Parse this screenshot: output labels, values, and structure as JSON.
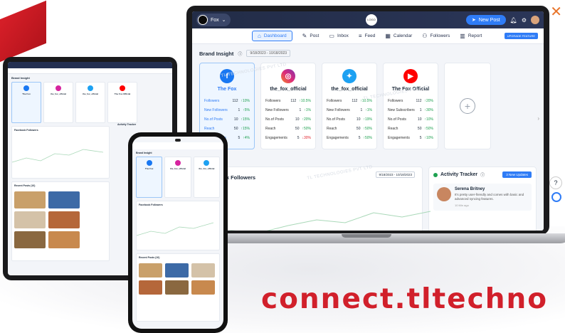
{
  "topbar": {
    "brand_name": "Fox",
    "center_logo_text": "LOGO",
    "new_post_label": "New Post"
  },
  "nav": {
    "items": [
      {
        "label": "Dashboard",
        "icon": "home-icon",
        "active": true
      },
      {
        "label": "Post",
        "icon": "edit-icon",
        "active": false
      },
      {
        "label": "Inbox",
        "icon": "inbox-icon",
        "active": false
      },
      {
        "label": "Feed",
        "icon": "feed-icon",
        "active": false
      },
      {
        "label": "Calendar",
        "icon": "calendar-icon",
        "active": false
      },
      {
        "label": "Followers",
        "icon": "followers-icon",
        "active": false
      },
      {
        "label": "Report",
        "icon": "report-icon",
        "active": false
      }
    ],
    "upgrade_label": "UPGRADE FEATURE"
  },
  "brand_insight": {
    "title": "Brand Insight",
    "date_range": "9/18/2023 - 10/18/2023"
  },
  "accounts": [
    {
      "name": "The Fox",
      "network": "facebook",
      "color": "#1877f2",
      "glyph": "f",
      "selected": true,
      "stats": [
        {
          "label": "Followers",
          "value": "112",
          "change": "10%",
          "dir": "up"
        },
        {
          "label": "New Followers",
          "value": "1",
          "change": "5%",
          "dir": "up"
        },
        {
          "label": "No.of Posts",
          "value": "10",
          "change": "15%",
          "dir": "up"
        },
        {
          "label": "Reach",
          "value": "50",
          "change": "15%",
          "dir": "up"
        },
        {
          "label": "Engagements",
          "value": "5",
          "change": "4%",
          "dir": "up"
        }
      ]
    },
    {
      "name": "the_fox_official",
      "network": "instagram",
      "color": "#d6249f",
      "glyph": "◎",
      "selected": false,
      "stats": [
        {
          "label": "Followers",
          "value": "112",
          "change": "10.5%",
          "dir": "up"
        },
        {
          "label": "New Followers",
          "value": "1",
          "change": "1%",
          "dir": "up"
        },
        {
          "label": "No.of Posts",
          "value": "10",
          "change": "20%",
          "dir": "up"
        },
        {
          "label": "Reach",
          "value": "50",
          "change": "50%",
          "dir": "up"
        },
        {
          "label": "Engagements",
          "value": "5",
          "change": "30%",
          "dir": "down"
        }
      ]
    },
    {
      "name": "the_fox_official",
      "network": "twitter",
      "color": "#1da1f2",
      "glyph": "✦",
      "selected": false,
      "stats": [
        {
          "label": "Followers",
          "value": "112",
          "change": "10.5%",
          "dir": "up"
        },
        {
          "label": "New Followers",
          "value": "1",
          "change": "1%",
          "dir": "up"
        },
        {
          "label": "No.of Posts",
          "value": "10",
          "change": "19%",
          "dir": "up"
        },
        {
          "label": "Reach",
          "value": "50",
          "change": "50%",
          "dir": "up"
        },
        {
          "label": "Engagements",
          "value": "5",
          "change": "50%",
          "dir": "up"
        }
      ]
    },
    {
      "name": "The Fox Official",
      "network": "youtube",
      "color": "#ff0000",
      "glyph": "▶",
      "selected": false,
      "stats": [
        {
          "label": "Followers",
          "value": "112",
          "change": "20%",
          "dir": "up"
        },
        {
          "label": "New Subscribers",
          "value": "1",
          "change": "30%",
          "dir": "up"
        },
        {
          "label": "No.of Posts",
          "value": "10",
          "change": "10%",
          "dir": "up"
        },
        {
          "label": "Reach",
          "value": "50",
          "change": "50%",
          "dir": "up"
        },
        {
          "label": "Engagements",
          "value": "5",
          "change": "10%",
          "dir": "up"
        }
      ]
    }
  ],
  "facebook_followers": {
    "title": "Facebook Followers",
    "date_range": "9/18/2023 - 10/18/2023"
  },
  "activity": {
    "title": "Activity Tracker",
    "updates_label": "3 New Updates",
    "item_name": "Serena Britney",
    "item_text": "It's pretty user-friendly and comes with basic and advanced syncing features.",
    "item_time": "10 Min ago"
  },
  "watermark": "TL TECHNOLOGIES PVT LTD",
  "tablet": {
    "brand_insight": "Brand Insight",
    "followers_title": "Facebook Followers",
    "activity_title": "Activity Tracker",
    "recent_posts": "Recent Posts (10)",
    "mini_names": [
      "The Fox",
      "the_fox_official",
      "the_fox_official",
      "The Fox Official"
    ]
  },
  "phone": {
    "brand_insight": "Brand Insight",
    "followers_title": "Facebook Followers",
    "recent_posts": "Recent Posts (10)",
    "mini_names": [
      "The Fox",
      "the_fox_official",
      "the_fox_official"
    ]
  },
  "brand_url": "connect.tltechno"
}
